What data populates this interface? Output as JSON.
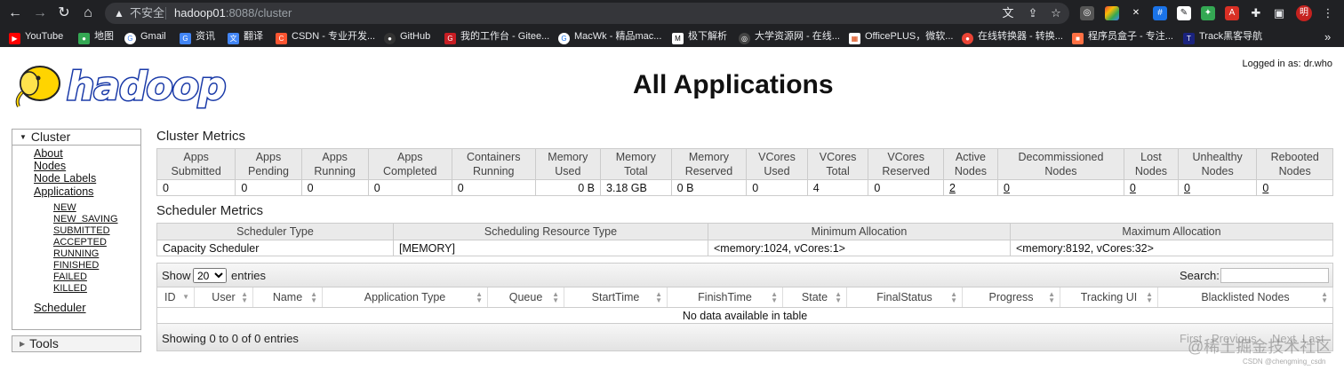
{
  "browser": {
    "security_label": "不安全",
    "url_host": "hadoop01",
    "url_path": ":8088/cluster",
    "avatar_text": "明",
    "bookmarks": [
      "YouTube",
      "地图",
      "Gmail",
      "资讯",
      "翻译",
      "CSDN - 专业开发...",
      "GitHub",
      "我的工作台 - Gitee...",
      "MacWk - 精品mac...",
      "极下解析",
      "大学资源网 - 在线...",
      "OfficePLUS，微软...",
      "在线转换器 - 转换...",
      "程序员盒子 - 专注...",
      "Track黑客导航"
    ],
    "icons": [
      "back-icon",
      "forward-icon",
      "reload-icon",
      "home-icon",
      "translate-icon",
      "share-icon",
      "star-icon",
      "extensions-icon",
      "sidepanel-icon",
      "more-icon",
      "more-bookmarks-icon"
    ]
  },
  "page": {
    "logged_in": "Logged in as: dr.who",
    "title": "All Applications",
    "logo_text": "hadoop"
  },
  "nav": {
    "cluster": "Cluster",
    "links": [
      "About",
      "Nodes",
      "Node Labels",
      "Applications"
    ],
    "states": [
      "NEW",
      "NEW_SAVING",
      "SUBMITTED",
      "ACCEPTED",
      "RUNNING",
      "FINISHED",
      "FAILED",
      "KILLED"
    ],
    "scheduler": "Scheduler",
    "tools": "Tools"
  },
  "cluster_metrics": {
    "title": "Cluster Metrics",
    "headers": [
      [
        "Apps",
        "Submitted"
      ],
      [
        "Apps",
        "Pending"
      ],
      [
        "Apps",
        "Running"
      ],
      [
        "Apps",
        "Completed"
      ],
      [
        "Containers",
        "Running"
      ],
      [
        "Memory",
        "Used"
      ],
      [
        "Memory",
        "Total"
      ],
      [
        "Memory",
        "Reserved"
      ],
      [
        "VCores",
        "Used"
      ],
      [
        "VCores",
        "Total"
      ],
      [
        "VCores",
        "Reserved"
      ],
      [
        "Active",
        "Nodes"
      ],
      [
        "Decommissioned",
        "Nodes"
      ],
      [
        "Lost",
        "Nodes"
      ],
      [
        "Unhealthy",
        "Nodes"
      ],
      [
        "Rebooted",
        "Nodes"
      ]
    ],
    "values": [
      "0",
      "0",
      "0",
      "0",
      "0",
      "0 B",
      "3.18 GB",
      "0 B",
      "0",
      "4",
      "0",
      "2",
      "0",
      "0",
      "0",
      "0"
    ]
  },
  "scheduler_metrics": {
    "title": "Scheduler Metrics",
    "headers": [
      "Scheduler Type",
      "Scheduling Resource Type",
      "Minimum Allocation",
      "Maximum Allocation"
    ],
    "values": [
      "Capacity Scheduler",
      "[MEMORY]",
      "<memory:1024, vCores:1>",
      "<memory:8192, vCores:32>"
    ]
  },
  "apps_table": {
    "show_label": "Show",
    "page_size": "20",
    "entries_label": "entries",
    "search_label": "Search:",
    "columns": [
      "ID",
      "User",
      "Name",
      "Application Type",
      "Queue",
      "StartTime",
      "FinishTime",
      "State",
      "FinalStatus",
      "Progress",
      "Tracking UI",
      "Blacklisted Nodes"
    ],
    "empty_message": "No data available in table",
    "info": "Showing 0 to 0 of 0 entries",
    "pager": [
      "First",
      "Previous",
      "Next",
      "Last"
    ]
  },
  "watermark": {
    "main": "@稀土掘金技术社区",
    "small": "CSDN @chengming_csdn"
  }
}
